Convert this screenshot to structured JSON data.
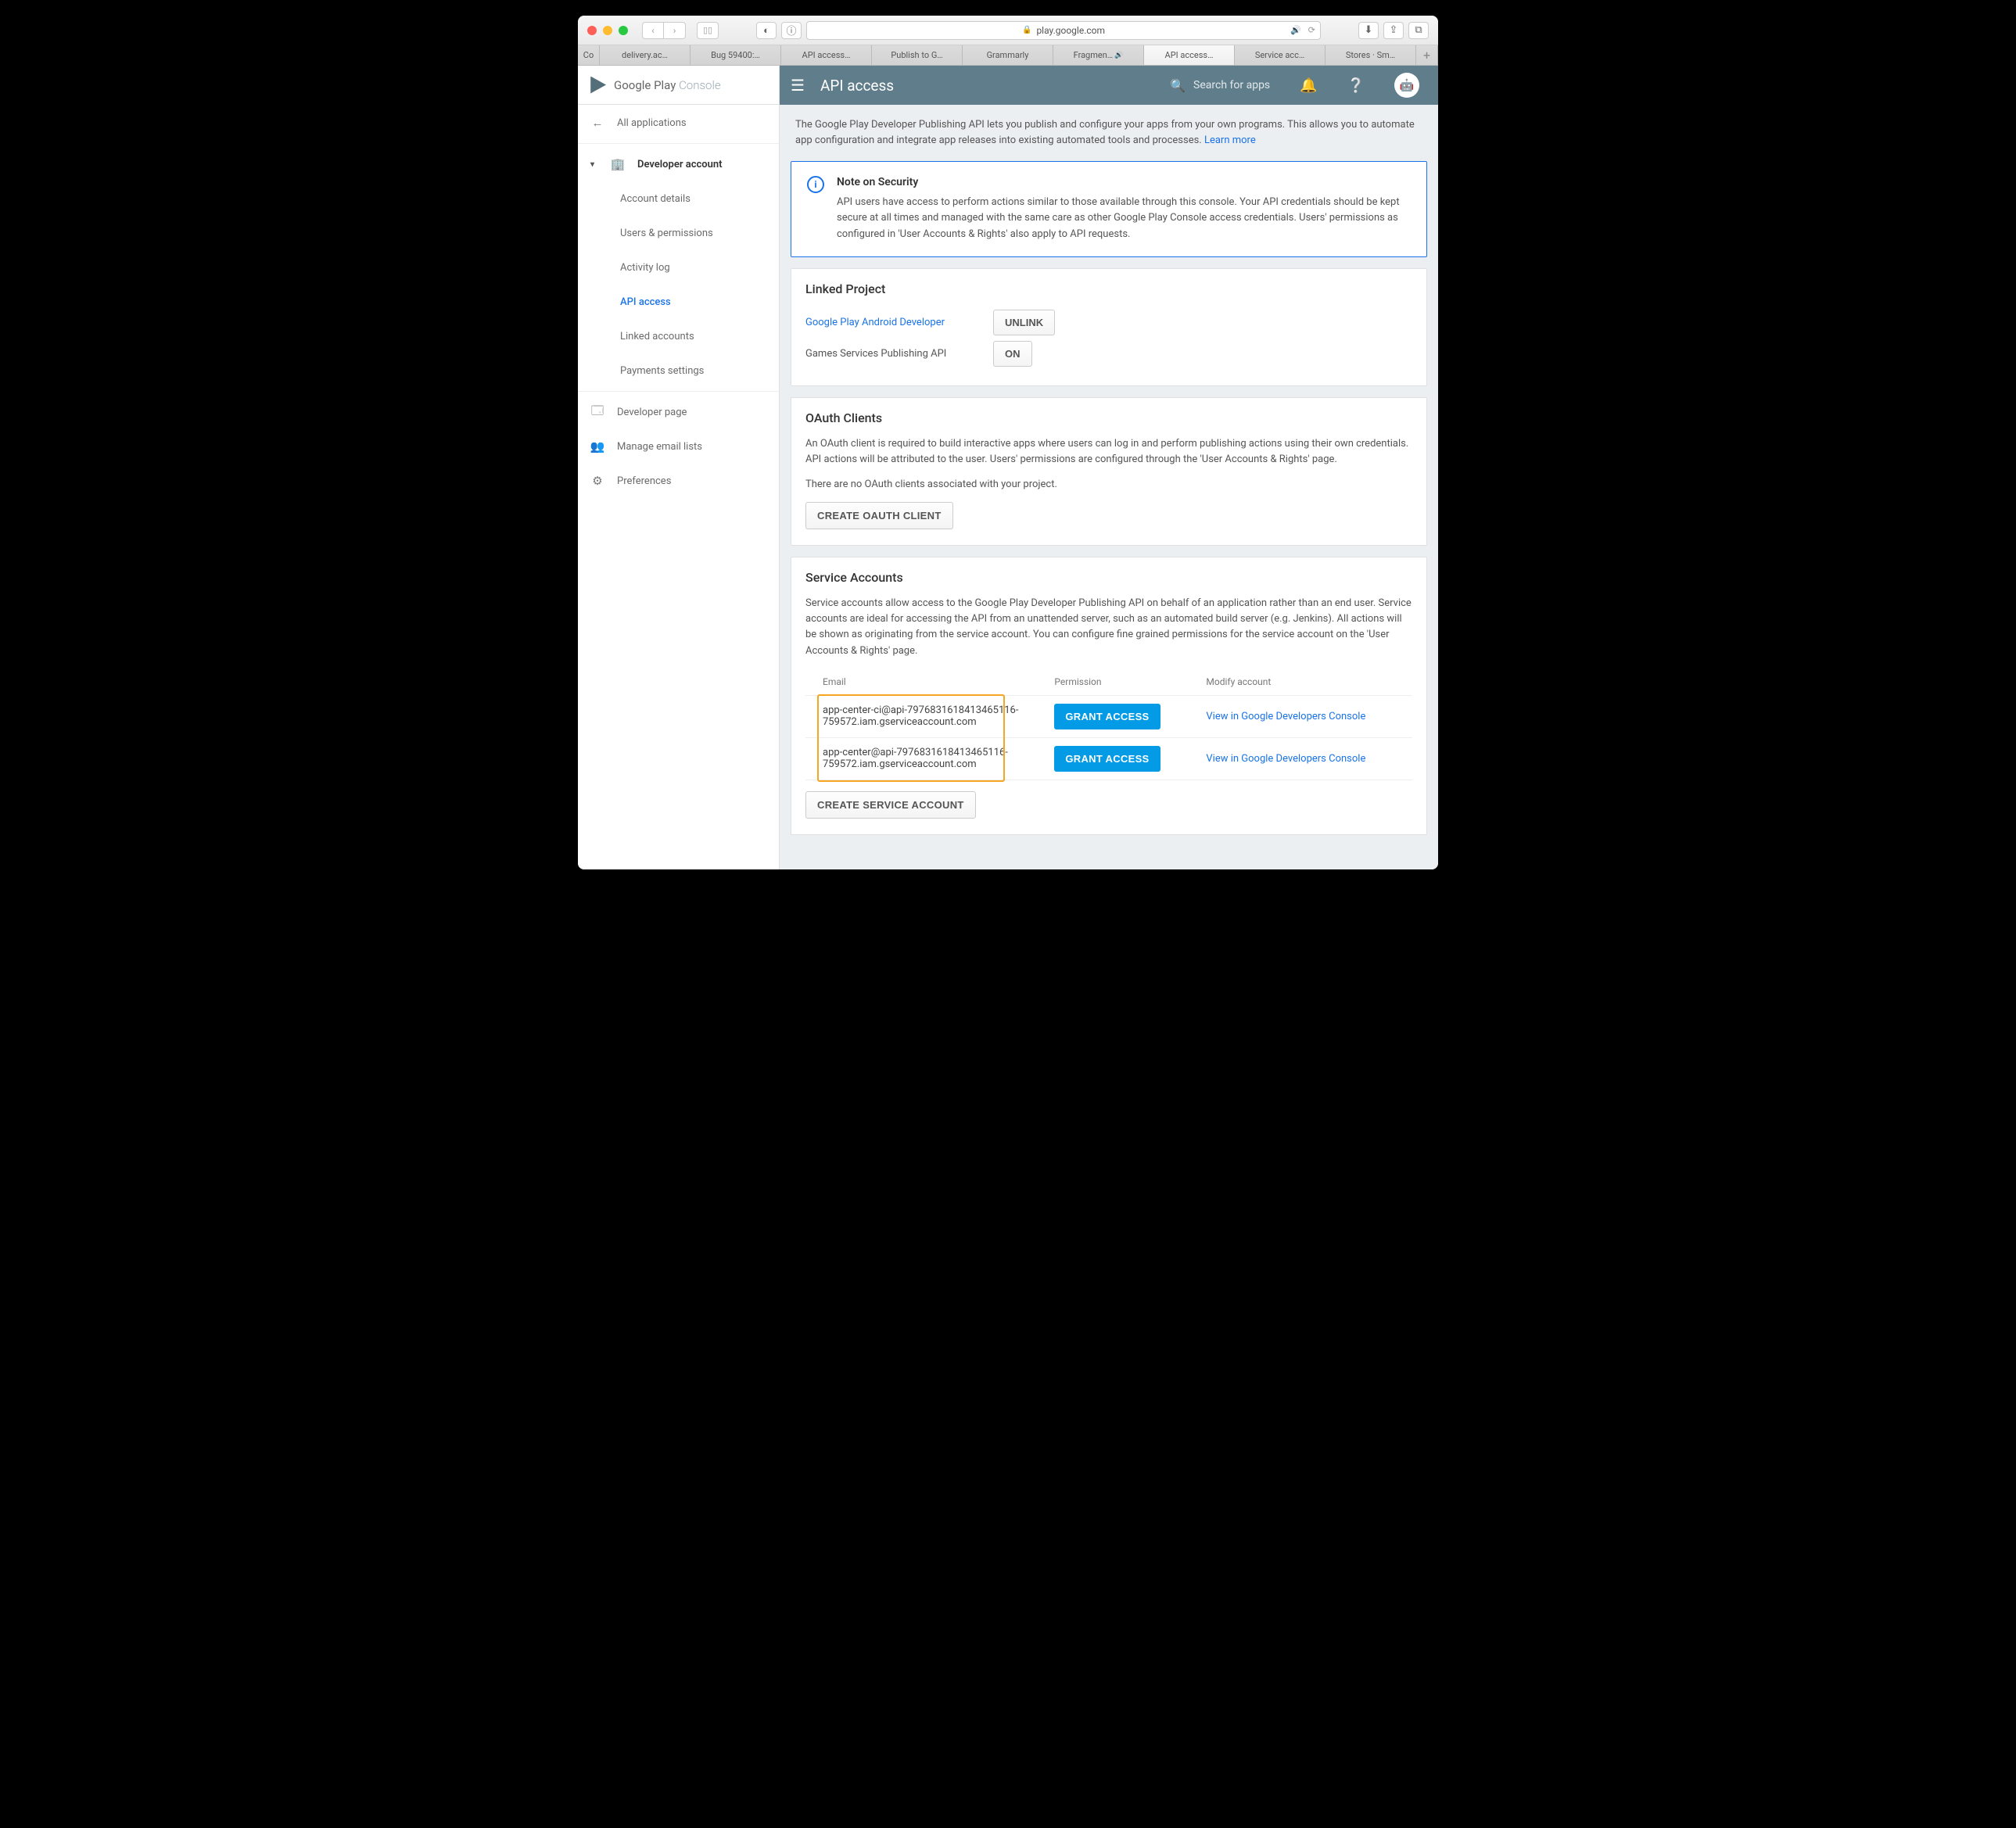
{
  "browser": {
    "url_host": "play.google.com",
    "tabs": [
      "Co",
      "delivery.ac…",
      "Bug 59400:…",
      "API access…",
      "Publish to G…",
      "Grammarly",
      "Fragmen…",
      "API access…",
      "Service acc…",
      "Stores · Sm…"
    ],
    "active_tab_index": 7,
    "sound_tab_indexes": [
      6
    ]
  },
  "logo": {
    "a": "Google Play ",
    "b": "Console"
  },
  "header": {
    "title": "API access",
    "search_placeholder": "Search for apps"
  },
  "sidebar": {
    "back": "All applications",
    "group": "Developer account",
    "sub": [
      "Account details",
      "Users & permissions",
      "Activity log",
      "API access",
      "Linked accounts",
      "Payments settings"
    ],
    "active_sub": 3,
    "bottom": [
      "Developer page",
      "Manage email lists",
      "Preferences"
    ]
  },
  "intro": {
    "text": "The Google Play Developer Publishing API lets you publish and configure your apps from your own programs. This allows you to automate app configuration and integrate app releases into existing automated tools and processes. ",
    "link": "Learn more"
  },
  "alert": {
    "title": "Note on Security",
    "body": "API users have access to perform actions similar to those available through this console. Your API credentials should be kept secure at all times and managed with the same care as other Google Play Console access credentials. Users' permissions as configured in 'User Accounts & Rights' also apply to API requests."
  },
  "linked": {
    "title": "Linked Project",
    "rows": [
      {
        "label": "Google Play Android Developer",
        "link": true,
        "btn": "UNLINK"
      },
      {
        "label": "Games Services Publishing API",
        "link": false,
        "btn": "ON"
      }
    ]
  },
  "oauth": {
    "title": "OAuth Clients",
    "desc": "An OAuth client is required to build interactive apps where users can log in and perform publishing actions using their own credentials. API actions will be attributed to the user. Users' permissions are configured through the 'User Accounts & Rights' page.",
    "empty": "There are no OAuth clients associated with your project.",
    "create": "CREATE OAUTH CLIENT"
  },
  "svc": {
    "title": "Service Accounts",
    "desc": "Service accounts allow access to the Google Play Developer Publishing API on behalf of an application rather than an end user. Service accounts are ideal for accessing the API from an unattended server, such as an automated build server (e.g. Jenkins). All actions will be shown as originating from the service account. You can configure fine grained permissions for the service account on the 'User Accounts & Rights' page.",
    "cols": [
      "Email",
      "Permission",
      "Modify account"
    ],
    "rows": [
      {
        "email": "app-center-ci@api-7976831618413465116-759572.iam.gserviceaccount.com",
        "perm": "GRANT ACCESS",
        "mod": "View in Google Developers Console"
      },
      {
        "email": "app-center@api-7976831618413465116-759572.iam.gserviceaccount.com",
        "perm": "GRANT ACCESS",
        "mod": "View in Google Developers Console"
      }
    ],
    "create": "CREATE SERVICE ACCOUNT"
  }
}
